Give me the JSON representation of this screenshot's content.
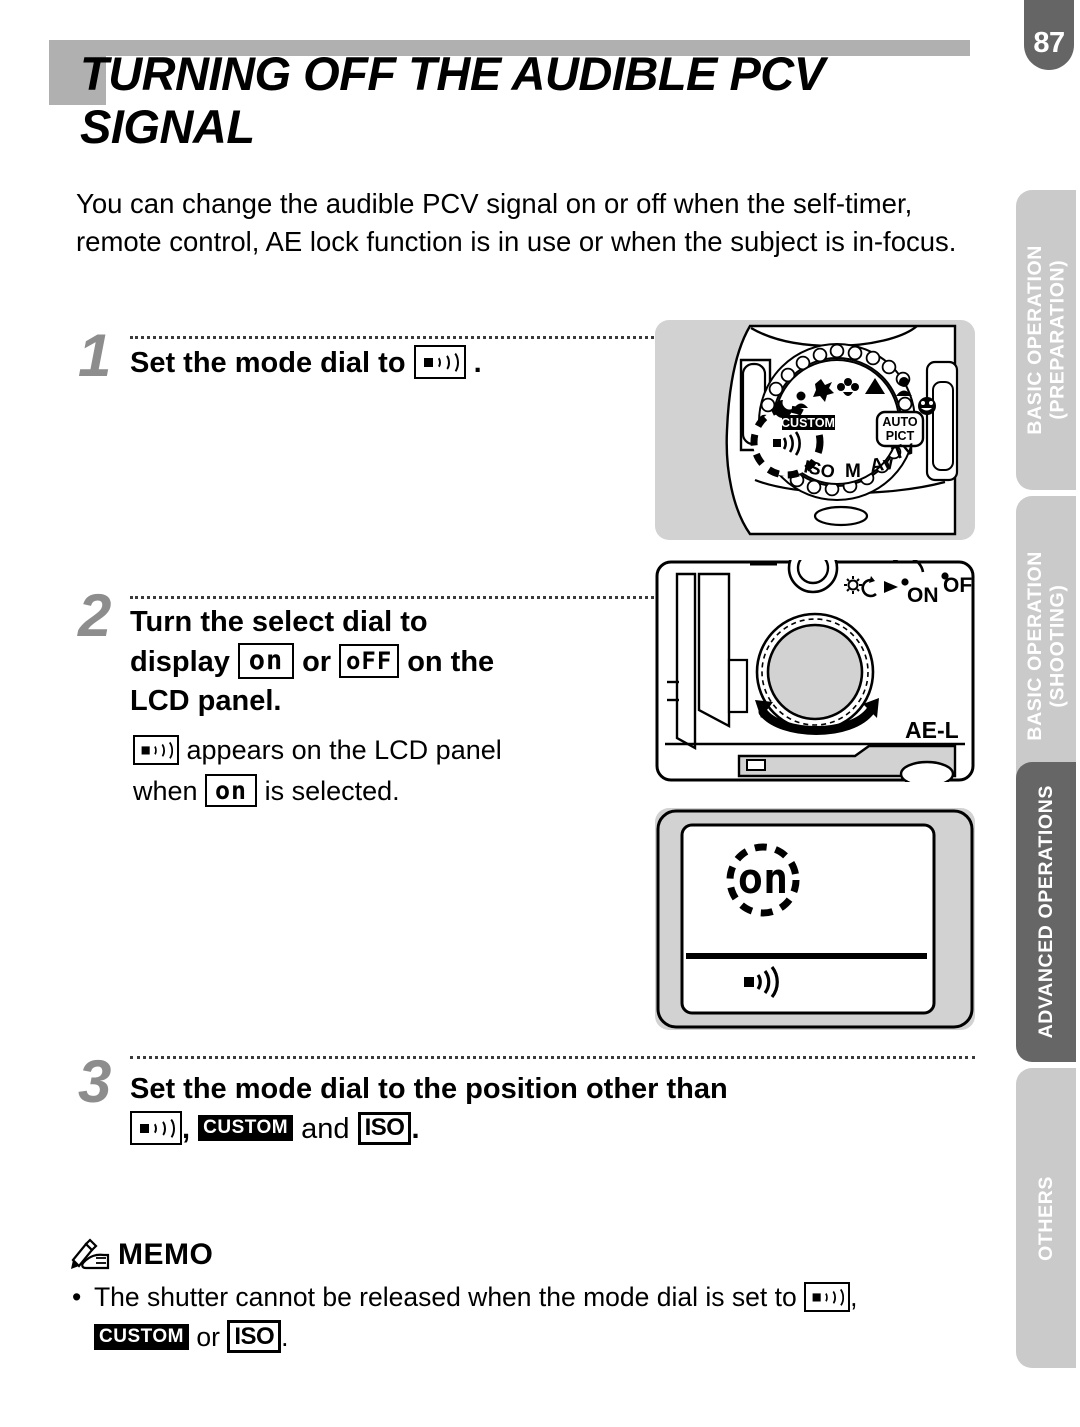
{
  "page": {
    "number": "87",
    "title": "TURNING OFF THE AUDIBLE PCV SIGNAL",
    "intro": "You can change the audible PCV signal on or off when the self-timer, remote control, AE lock function is in use or when the subject is in-focus."
  },
  "steps": [
    {
      "number": "1",
      "text_before": "Set the mode dial to",
      "text_after": ".",
      "icon": "beeper-icon"
    },
    {
      "number": "2",
      "line1": "Turn the select dial to",
      "line2_a": "display",
      "line2_b": "or",
      "line2_c": "on the",
      "line3": "LCD panel.",
      "icon_on": "on",
      "icon_off": "oFF",
      "note_a": "appears on the LCD panel",
      "note_b": "when",
      "note_c": "is selected."
    },
    {
      "number": "3",
      "line1": "Set the mode dial to the position other than",
      "comma": ",",
      "and": "and",
      "period": ".",
      "icon_beeper": "beeper-icon",
      "icon_custom": "CUSTOM",
      "icon_iso": "ISO"
    }
  ],
  "memo": {
    "heading": "MEMO",
    "icon": "hand-pen-icon",
    "bullet": "•",
    "text_a": "The shutter cannot be released when the mode dial is set to",
    "comma": ",",
    "or": "or",
    "period": ".",
    "icon_beeper": "beeper-icon",
    "icon_custom": "CUSTOM",
    "icon_iso": "ISO"
  },
  "illustrations": {
    "mode_dial": {
      "name": "camera-top-mode-dial",
      "labels": [
        "CUSTOM",
        "AUTO PICT",
        "Tv",
        "Av",
        "M",
        "ISO"
      ]
    },
    "select_dial": {
      "name": "camera-select-dial",
      "labels": [
        "ON",
        "OF",
        "AE-L"
      ]
    },
    "lcd_panel": {
      "name": "lcd-panel-display",
      "display_value": "on",
      "indicator": "beeper-icon"
    }
  },
  "side_tabs": [
    {
      "label": "BASIC OPERATION\n(PREPARATION)",
      "active": false
    },
    {
      "label": "BASIC OPERATION\n(SHOOTING)",
      "active": false
    },
    {
      "label": "ADVANCED OPERATIONS",
      "active": true
    },
    {
      "label": "OTHERS",
      "active": false
    }
  ],
  "colors": {
    "tab_active": "#666666",
    "tab_inactive": "#cacaca",
    "header_gray": "#b0b0b0",
    "illus_bg": "#d2d2d2",
    "step_number": "#8d8d8d"
  }
}
